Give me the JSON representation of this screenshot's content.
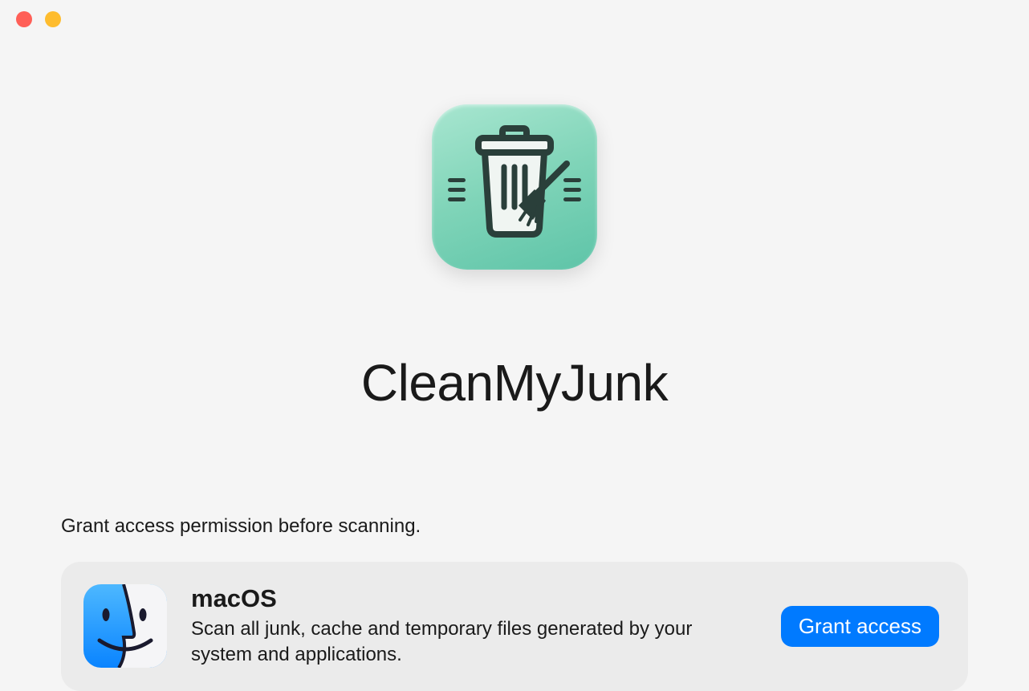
{
  "app": {
    "title": "CleanMyJunk"
  },
  "permission": {
    "prompt": "Grant access permission before scanning.",
    "card": {
      "title": "macOS",
      "description": "Scan all junk, cache and temporary files generated by your system and applications.",
      "button_label": "Grant access"
    }
  },
  "icons": {
    "app_icon": "trash-broom-icon",
    "os_icon": "finder-icon"
  },
  "colors": {
    "accent": "#007aff",
    "app_icon_gradient_start": "#a8e6d0",
    "app_icon_gradient_end": "#5ec4a8"
  }
}
